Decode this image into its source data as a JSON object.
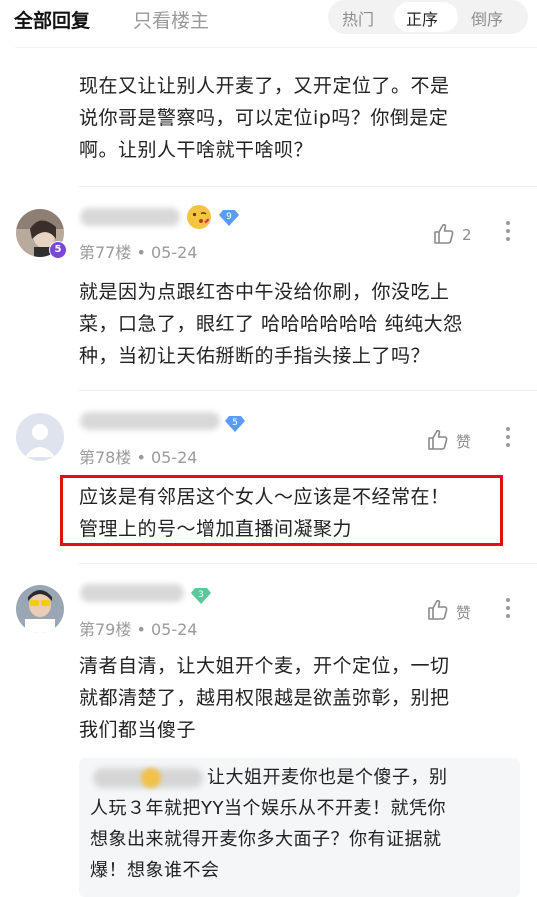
{
  "header": {
    "tab_all": "全部回复",
    "tab_owner_only": "只看楼主",
    "sort_hot": "热门",
    "sort_asc": "正序",
    "sort_desc": "倒序"
  },
  "top_comment": {
    "lines": [
      "现在又让让别人开麦了，又开定位了。不是",
      "说你哥是警察吗，可以定位ip吗？你倒是定",
      "啊。让别人干啥就干啥呗？"
    ]
  },
  "comments": [
    {
      "floor_meta": "第77楼 • 05-24",
      "level": "5",
      "gem_level": "9",
      "likes": "2",
      "lines": [
        "就是因为点跟红杏中午没给你刷，你没吃上",
        "菜，口急了，眼红了 哈哈哈哈哈哈 纯纯大怨",
        "种，当初让天佑掰断的手指头接上了吗？"
      ]
    },
    {
      "floor_meta": "第78楼 • 05-24",
      "gem_level": "5",
      "like_label": "赞",
      "lines": [
        "应该是有邻居这个女人～应该是不经常在！",
        "管理上的号～增加直播间凝聚力"
      ]
    },
    {
      "floor_meta": "第79楼 • 05-24",
      "gem_level": "3",
      "like_label": "赞",
      "lines": [
        "清者自清，让大姐开个麦，开个定位，一切",
        "就都清楚了，越用权限越是欲盖弥彰，别把",
        "我们都当傻子"
      ],
      "reply_lines": [
        "让大姐开麦你也是个傻子，别",
        "人玩３年就把YY当个娱乐从不开麦！就凭你",
        "想象出来就得开麦你多大面子？你有证据就",
        "爆！想象谁不会"
      ]
    }
  ],
  "colors": {
    "highlight_border": "#e01010",
    "level_badge": "#7b47d6",
    "gem_blue": "#5b9cf2",
    "gem_green": "#5cc79a"
  }
}
